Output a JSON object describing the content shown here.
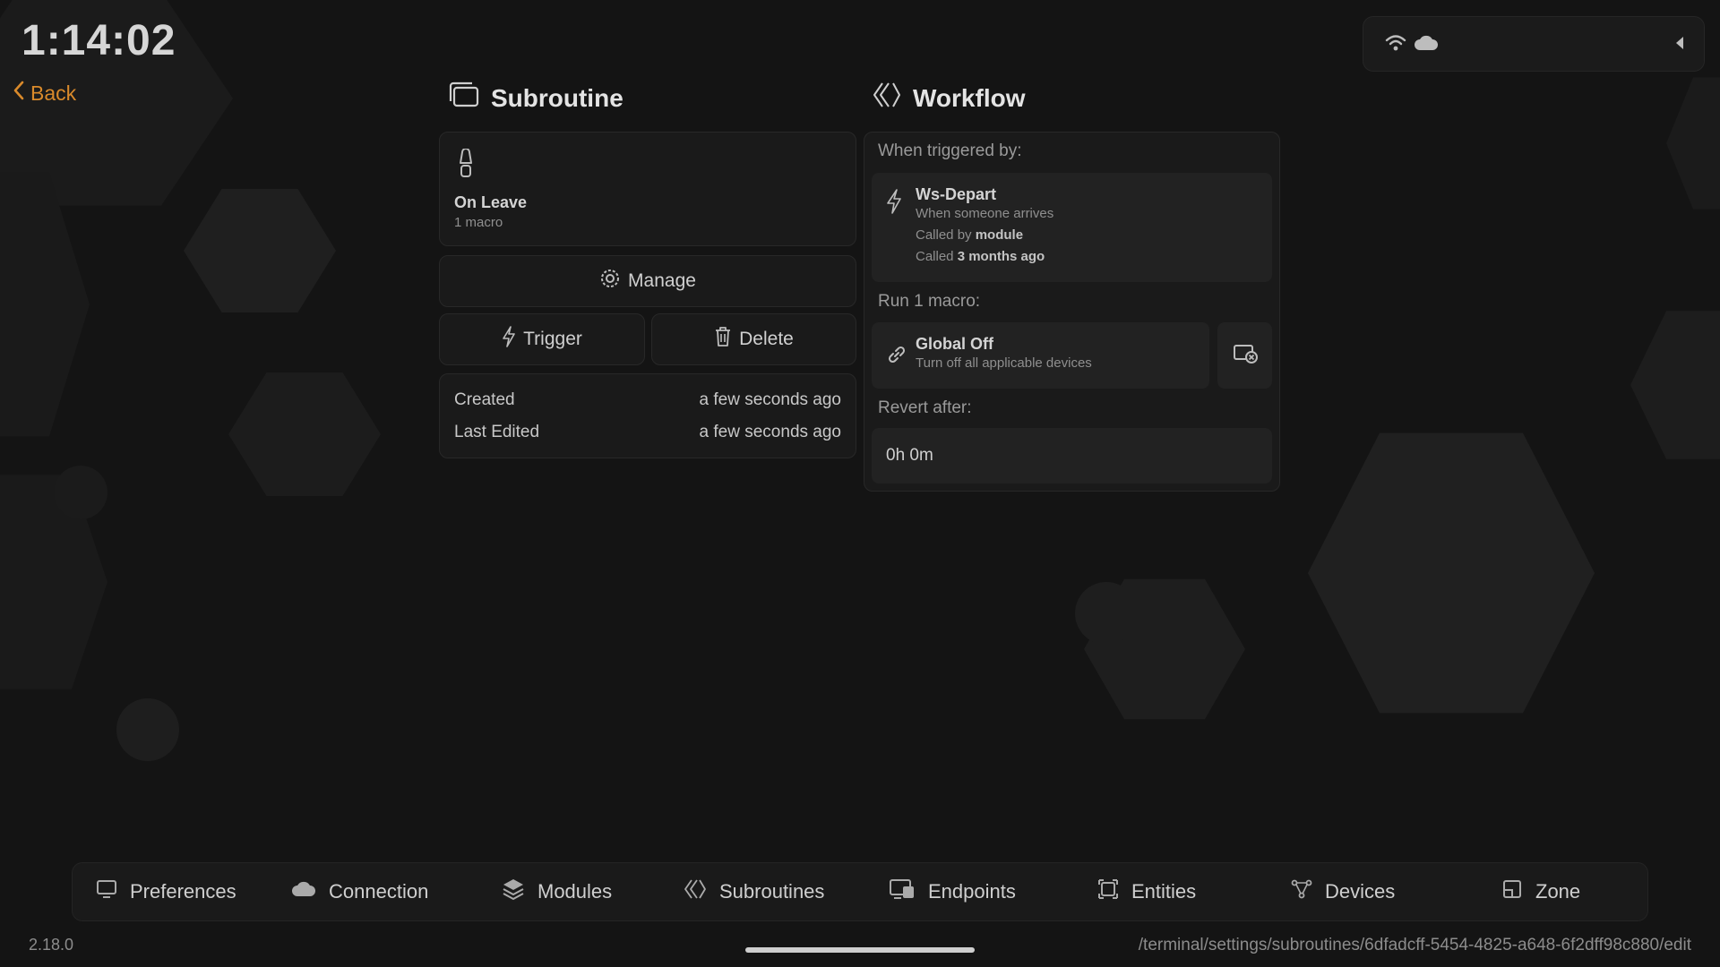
{
  "clock": "1:14:02",
  "back_label": "Back",
  "subroutine": {
    "title": "Subroutine",
    "name": "On Leave",
    "macro_count": "1 macro",
    "manage_label": "Manage",
    "trigger_label": "Trigger",
    "delete_label": "Delete",
    "created_label": "Created",
    "created_value": "a few seconds ago",
    "edited_label": "Last Edited",
    "edited_value": "a few seconds ago"
  },
  "workflow": {
    "title": "Workflow",
    "triggered_label": "When triggered by:",
    "trigger": {
      "name": "Ws-Depart",
      "description": "When someone arrives",
      "called_by_prefix": "Called by",
      "called_by_value": "module",
      "called_prefix": "Called",
      "called_value": "3 months ago"
    },
    "run_label": "Run 1 macro:",
    "macro": {
      "name": "Global Off",
      "description": "Turn off all applicable devices"
    },
    "revert_label": "Revert after:",
    "revert_value": "0h 0m"
  },
  "nav": {
    "items": [
      {
        "label": "Preferences",
        "icon": "monitor-icon"
      },
      {
        "label": "Connection",
        "icon": "cloud-icon"
      },
      {
        "label": "Modules",
        "icon": "layers-icon"
      },
      {
        "label": "Subroutines",
        "icon": "subroutines-icon"
      },
      {
        "label": "Endpoints",
        "icon": "endpoints-icon"
      },
      {
        "label": "Entities",
        "icon": "entities-icon"
      },
      {
        "label": "Devices",
        "icon": "devices-icon"
      },
      {
        "label": "Zone",
        "icon": "zone-icon"
      }
    ]
  },
  "version": "2.18.0",
  "path": "/terminal/settings/subroutines/6dfadcff-5454-4825-a648-6f2dff98c880/edit",
  "colors": {
    "accent": "#d98a2b",
    "background": "#141414",
    "card": "#1a1a1a",
    "inner": "#222222"
  }
}
